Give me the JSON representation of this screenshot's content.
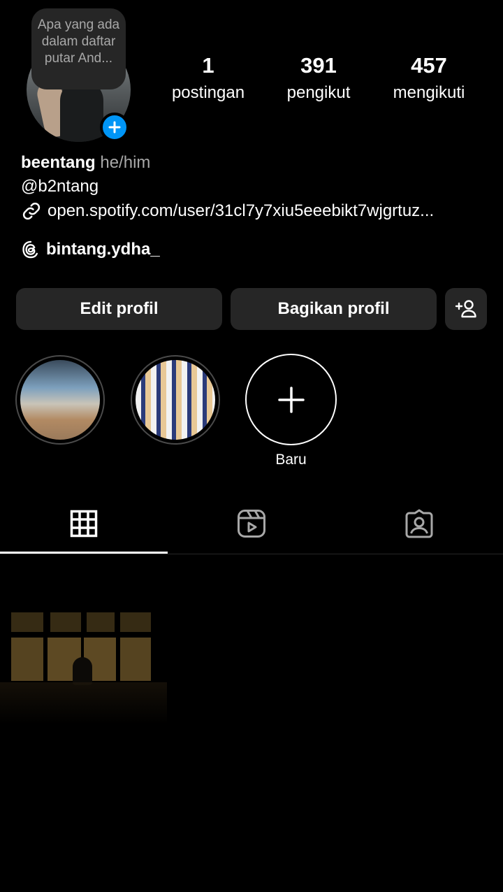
{
  "profile": {
    "note": "Apa yang ada dalam daftar putar And...",
    "stats": [
      {
        "value": "1",
        "label": "postingan"
      },
      {
        "value": "391",
        "label": "pengikut"
      },
      {
        "value": "457",
        "label": "mengikuti"
      }
    ],
    "name": "beentang",
    "pronouns": "he/him",
    "handle": "@b2ntang",
    "link": "open.spotify.com/user/31cl7y7xiu5eeebikt7wjgrtuz...",
    "threads_username": "bintang.ydha_"
  },
  "buttons": {
    "edit": "Edit profil",
    "share": "Bagikan profil"
  },
  "highlights": {
    "new_label": "Baru"
  },
  "icons": {
    "add": "plus-icon",
    "link": "link-icon",
    "threads": "threads-icon",
    "discover_people": "add-person-icon",
    "grid": "grid-icon",
    "reels": "reels-icon",
    "tagged": "tagged-icon"
  },
  "colors": {
    "background": "#000000",
    "button": "#262626",
    "accent": "#0095f6",
    "muted": "#a8a8a8"
  }
}
